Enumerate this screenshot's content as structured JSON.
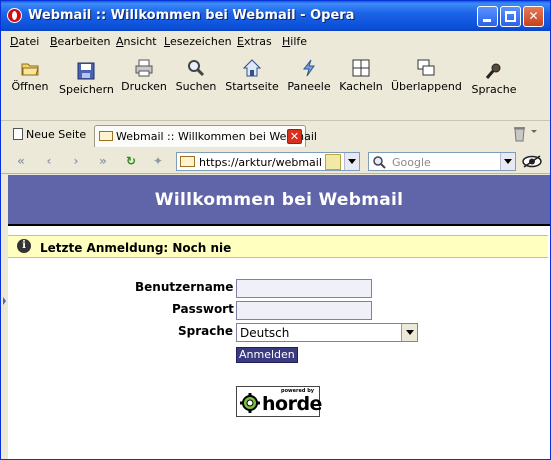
{
  "window": {
    "title": "Webmail :: Willkommen bei Webmail - Opera",
    "icon": "opera-icon"
  },
  "menu": {
    "items": [
      {
        "key": "D",
        "rest": "atei"
      },
      {
        "key": "B",
        "rest": "earbeiten"
      },
      {
        "key": "A",
        "rest": "nsicht"
      },
      {
        "key": "L",
        "rest": "esezeichen"
      },
      {
        "key": "E",
        "rest": "xtras"
      },
      {
        "key": "H",
        "rest": "ilfe"
      }
    ]
  },
  "toolbar": {
    "items": [
      {
        "label": "Öffnen",
        "icon": "folder-open-icon"
      },
      {
        "label": "Speichern",
        "icon": "save-icon"
      },
      {
        "label": "Drucken",
        "icon": "printer-icon"
      },
      {
        "label": "Suchen",
        "icon": "search-icon"
      },
      {
        "label": "Startseite",
        "icon": "home-icon"
      },
      {
        "label": "Paneele",
        "icon": "panels-icon"
      },
      {
        "label": "Kacheln",
        "icon": "tile-icon"
      },
      {
        "label": "Überlappend",
        "icon": "cascade-icon"
      },
      {
        "label": "Sprache",
        "icon": "voice-icon"
      }
    ]
  },
  "tabs": {
    "new_tab": "Neue Seite",
    "active_tab": "Webmail :: Willkommen bei Webmail"
  },
  "address": {
    "url": "https://arktur/webmail",
    "search_placeholder": "Google"
  },
  "page": {
    "banner_title": "Willkommen bei Webmail",
    "last_login": "Letzte Anmeldung: Noch nie",
    "username_label": "Benutzername",
    "password_label": "Passwort",
    "language_label": "Sprache",
    "language_value": "Deutsch",
    "login_button": "Anmelden",
    "logo_tagline": "powered by",
    "logo_brand": "horde"
  },
  "colors": {
    "banner": "#6064a8",
    "notice": "#ffffc0",
    "titlebar": "#0b50d8"
  }
}
